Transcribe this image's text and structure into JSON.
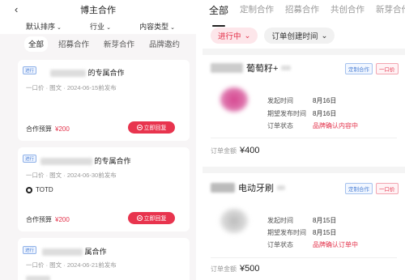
{
  "left": {
    "back": "‹",
    "title": "博主合作",
    "filters": [
      "默认排序",
      "行业",
      "内容类型"
    ],
    "tabs": [
      "全部",
      "招募合作",
      "新芽合作",
      "品牌邀约"
    ],
    "cards": [
      {
        "tag": "进行",
        "title_suffix": "的专属合作",
        "subtitle": "一口价 · 图文 · 2024-06-15前发布",
        "budget_label": "合作预算",
        "budget_value": "¥200",
        "reply_label": "立即回复"
      },
      {
        "tag": "进行",
        "title_suffix": "的专属合作",
        "subtitle": "一口价 · 图文 · 2024-06-30前发布",
        "brand": "TOTD",
        "budget_label": "合作预算",
        "budget_value": "¥200",
        "reply_label": "立即回复"
      },
      {
        "tag": "进行",
        "title_suffix": "属合作",
        "subtitle": "一口价 · 图文 · 2024-06-21前发布"
      }
    ]
  },
  "right": {
    "tabs": [
      "全部",
      "定制合作",
      "招募合作",
      "共创合作",
      "新芽合作"
    ],
    "chip_status": "进行中",
    "chip_time": "订单创建时间",
    "orders": [
      {
        "name": "葡萄籽+",
        "tag_type": "定制合作",
        "tag_price": "一口价",
        "rows": [
          [
            "发起时间",
            "8月16日"
          ],
          [
            "期望发布时间",
            "8月16日"
          ],
          [
            "订单状态",
            "品牌确认内容中"
          ]
        ],
        "amount_label": "订单金额",
        "amount": "¥400"
      },
      {
        "name": "电动牙刷",
        "tag_type": "定制合作",
        "tag_price": "一口价",
        "rows": [
          [
            "发起时间",
            "8月15日"
          ],
          [
            "期望发布时间",
            "8月15日"
          ],
          [
            "订单状态",
            "品牌确认订单中"
          ]
        ],
        "amount_label": "订单金额",
        "amount": "¥500"
      }
    ]
  }
}
